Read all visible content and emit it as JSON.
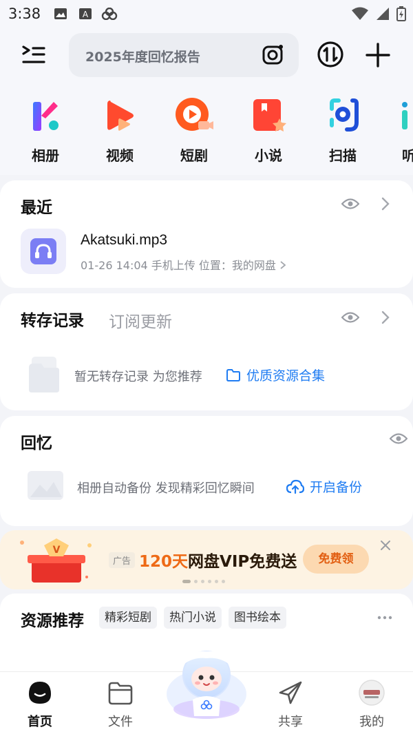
{
  "status_bar": {
    "time": "3:38"
  },
  "header": {
    "search_text": "2025年度回忆报告"
  },
  "apps": [
    {
      "label": "相册",
      "icon": "album-icon"
    },
    {
      "label": "视频",
      "icon": "video-icon"
    },
    {
      "label": "短剧",
      "icon": "short-drama-icon"
    },
    {
      "label": "小说",
      "icon": "novel-icon"
    },
    {
      "label": "扫描",
      "icon": "scan-icon"
    },
    {
      "label": "听",
      "icon": "listen-icon"
    }
  ],
  "recent": {
    "title": "最近",
    "file_name": "Akatsuki.mp3",
    "meta": "01-26 14:04  手机上传  位置：我的网盘"
  },
  "transfer": {
    "title": "转存记录",
    "tab2": "订阅更新",
    "empty_text": "暂无转存记录 为您推荐",
    "link": "优质资源合集"
  },
  "memory": {
    "title": "回忆",
    "empty_text": "相册自动备份 发现精彩回忆瞬间",
    "link": "开启备份"
  },
  "ad": {
    "tag": "广告",
    "highlight": "120天",
    "text": "网盘VIP免费送",
    "button": "免费领"
  },
  "resources": {
    "title": "资源推荐",
    "tags": [
      "精彩短剧",
      "热门小说",
      "图书绘本"
    ]
  },
  "nav": [
    {
      "label": "首页",
      "active": true
    },
    {
      "label": "文件",
      "active": false
    },
    {
      "label": "共享",
      "active": false
    },
    {
      "label": "我的",
      "active": false
    }
  ],
  "colors": {
    "accent": "#1f7cf2",
    "ad_highlight": "#ee6a16",
    "background": "#f3f4f8"
  }
}
